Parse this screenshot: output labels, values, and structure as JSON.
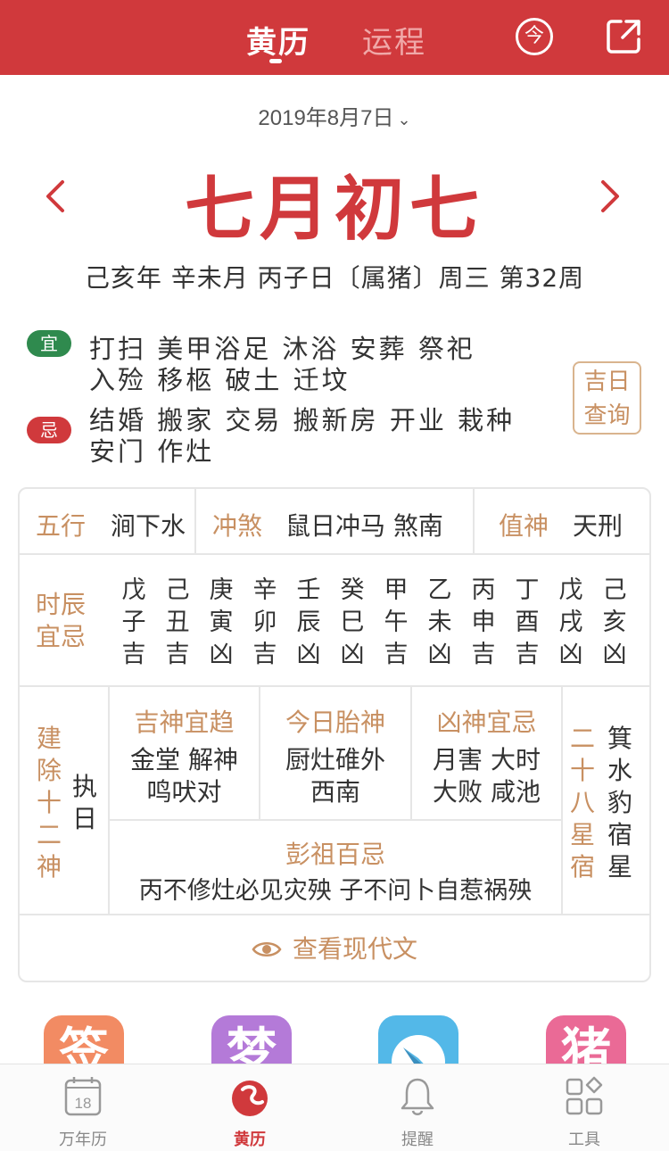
{
  "header": {
    "tabs": [
      "黄历",
      "运程"
    ],
    "today_label": "今"
  },
  "date": {
    "solar": "2019年8月7日",
    "lunar": "七月初七",
    "ganzhi": "己亥年 辛未月 丙子日〔属猪〕周三  第32周"
  },
  "yi": {
    "badge": "宜",
    "line1": "打扫  美甲浴足  沐浴  安葬  祭祀",
    "line2": "入殓 移柩 破土 迁坟"
  },
  "ji": {
    "badge": "忌",
    "line1": "结婚 搬家 交易 搬新房 开业 栽种",
    "line2": "安门 作灶"
  },
  "jiri_button": {
    "line1": "吉日",
    "line2": "查询"
  },
  "table": {
    "wuxing": {
      "label": "五行",
      "value": "涧下水"
    },
    "chongsha": {
      "label": "冲煞",
      "value": "鼠日冲马 煞南"
    },
    "zhishen": {
      "label": "值神",
      "value": "天刑"
    },
    "shichen_label": [
      "时辰",
      "宜忌"
    ],
    "shichen": [
      {
        "gan": "戊",
        "zhi": "子",
        "luck": "吉"
      },
      {
        "gan": "己",
        "zhi": "丑",
        "luck": "吉"
      },
      {
        "gan": "庚",
        "zhi": "寅",
        "luck": "凶"
      },
      {
        "gan": "辛",
        "zhi": "卯",
        "luck": "吉"
      },
      {
        "gan": "壬",
        "zhi": "辰",
        "luck": "凶"
      },
      {
        "gan": "癸",
        "zhi": "巳",
        "luck": "凶"
      },
      {
        "gan": "甲",
        "zhi": "午",
        "luck": "吉"
      },
      {
        "gan": "乙",
        "zhi": "未",
        "luck": "凶"
      },
      {
        "gan": "丙",
        "zhi": "申",
        "luck": "吉"
      },
      {
        "gan": "丁",
        "zhi": "酉",
        "luck": "吉"
      },
      {
        "gan": "戊",
        "zhi": "戌",
        "luck": "凶"
      },
      {
        "gan": "己",
        "zhi": "亥",
        "luck": "凶"
      }
    ],
    "jianchu": {
      "label": [
        "建",
        "除",
        "十",
        "二",
        "神"
      ],
      "value": [
        "执",
        "日"
      ]
    },
    "jishen": {
      "label": "吉神宜趋",
      "line1": "金堂 解神",
      "line2": "鸣吠对"
    },
    "taishen": {
      "label": "今日胎神",
      "line1": "厨灶碓外",
      "line2": "西南"
    },
    "xiongshen": {
      "label": "凶神宜忌",
      "line1": "月害 大时",
      "line2": "大败 咸池"
    },
    "pengzu": {
      "label": "彭祖百忌",
      "value": "丙不修灶必见灾殃 子不问卜自惹祸殃"
    },
    "xingxiu": {
      "label": [
        "二",
        "十",
        "八",
        "星",
        "宿"
      ],
      "value": [
        "箕",
        "水",
        "豹",
        "宿",
        "星"
      ]
    },
    "view_modern": "查看现代文"
  },
  "apps": [
    {
      "glyph": "签",
      "color": "#f28b63"
    },
    {
      "glyph": "梦",
      "color": "#b47ad8"
    },
    {
      "glyph": "",
      "icon": "compass-icon",
      "color": "#53b8e8"
    },
    {
      "glyph": "猪",
      "color": "#ea6a96"
    }
  ],
  "tabbar": {
    "calendar_day": "18",
    "items": [
      "万年历",
      "黄历",
      "提醒",
      "工具"
    ],
    "active": "黄历"
  },
  "colors": {
    "brand_red": "#d0393c",
    "gold": "#c89062",
    "green": "#2f8a4e"
  }
}
